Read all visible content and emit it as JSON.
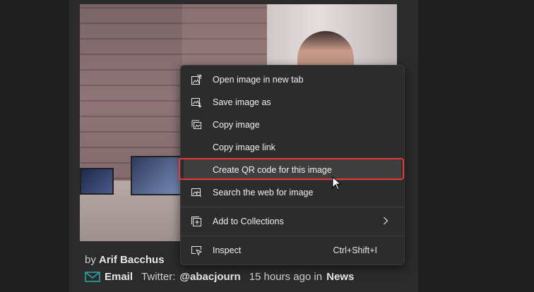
{
  "byline": {
    "prefix": "by",
    "author": "Arif Bacchus"
  },
  "meta": {
    "email_label": "Email",
    "twitter_prefix": "Twitter:",
    "twitter_handle": "@abacjourn",
    "time_text": "15 hours ago in",
    "category": "News"
  },
  "context_menu": {
    "items": [
      {
        "label": "Open image in new tab",
        "icon": "open-image-icon"
      },
      {
        "label": "Save image as",
        "icon": "save-image-icon"
      },
      {
        "label": "Copy image",
        "icon": "copy-image-icon"
      },
      {
        "label": "Copy image link",
        "icon": ""
      },
      {
        "label": "Create QR code for this image",
        "icon": ""
      },
      {
        "label": "Search the web for image",
        "icon": "search-image-icon"
      },
      {
        "label": "Add to Collections",
        "icon": "collections-icon"
      },
      {
        "label": "Inspect",
        "icon": "inspect-icon",
        "shortcut": "Ctrl+Shift+I"
      }
    ]
  },
  "colors": {
    "highlight_border": "#e5383b",
    "menu_bg": "#2c2c2c",
    "email_icon": "#2aa3a8"
  }
}
